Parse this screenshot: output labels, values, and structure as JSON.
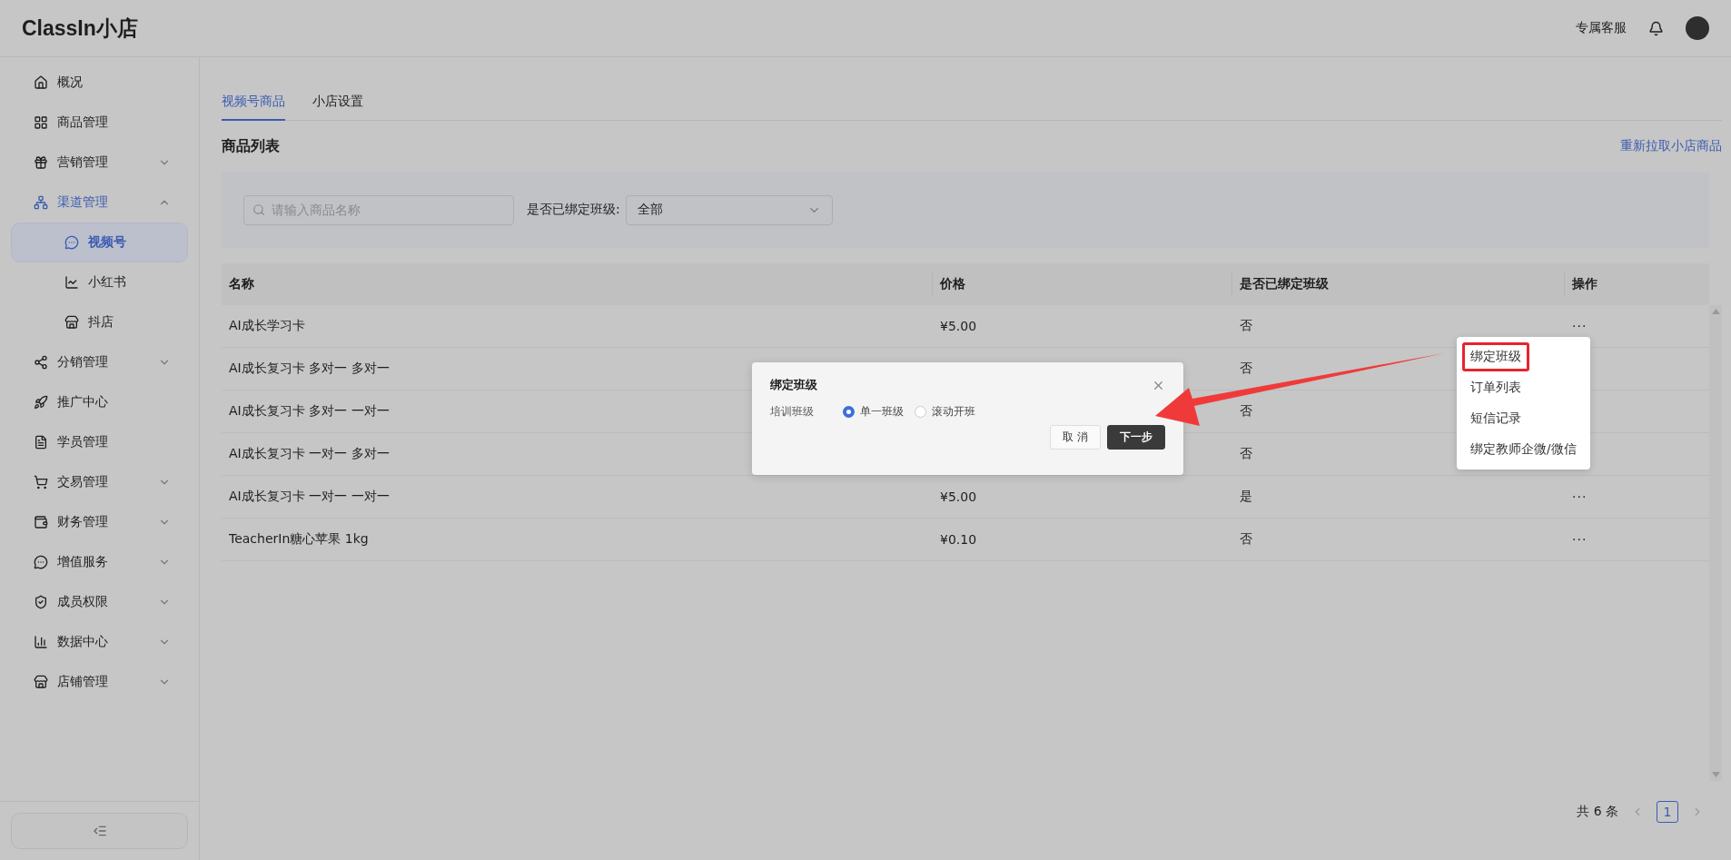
{
  "header": {
    "logo": "ClassIn小店",
    "support_link": "专属客服"
  },
  "sidebar": {
    "items": [
      {
        "label": "概况",
        "selected": false
      },
      {
        "label": "商品管理",
        "selected": false
      },
      {
        "label": "营销管理",
        "selected": false,
        "expanded": false
      },
      {
        "label": "渠道管理",
        "selected": false,
        "expanded": true,
        "children": [
          {
            "label": "视频号",
            "selected": true
          },
          {
            "label": "小红书",
            "selected": false
          },
          {
            "label": "抖店",
            "selected": false
          }
        ]
      },
      {
        "label": "分销管理",
        "selected": false,
        "expanded": false
      },
      {
        "label": "推广中心",
        "selected": false
      },
      {
        "label": "学员管理",
        "selected": false
      },
      {
        "label": "交易管理",
        "selected": false,
        "expanded": false
      },
      {
        "label": "财务管理",
        "selected": false,
        "expanded": false
      },
      {
        "label": "增值服务",
        "selected": false,
        "expanded": false
      },
      {
        "label": "成员权限",
        "selected": false,
        "expanded": false
      },
      {
        "label": "数据中心",
        "selected": false,
        "expanded": false
      },
      {
        "label": "店铺管理",
        "selected": false,
        "expanded": false
      }
    ]
  },
  "tabs": [
    {
      "label": "视频号商品",
      "selected": true
    },
    {
      "label": "小店设置",
      "selected": false
    }
  ],
  "section": {
    "title": "商品列表",
    "action": "重新拉取小店商品"
  },
  "filters": {
    "search": {
      "placeholder": "请输入商品名称"
    },
    "bound_label": "是否已绑定班级:",
    "bound_value": "全部"
  },
  "table": {
    "columns": [
      "名称",
      "价格",
      "是否已绑定班级",
      "操作"
    ],
    "rows": [
      {
        "name": "AI成长学习卡",
        "price": "¥5.00",
        "bound": "否",
        "ops": "···"
      },
      {
        "name": "AI成长复习卡 多对一 多对一",
        "bound": "否"
      },
      {
        "name": "AI成长复习卡 多对一 一对一",
        "bound": "否"
      },
      {
        "name": "AI成长复习卡 一对一 多对一",
        "bound": "否"
      },
      {
        "name": "AI成长复习卡 一对一 一对一",
        "price": "¥5.00",
        "bound": "是",
        "ops": "···"
      },
      {
        "name": "TeacherIn糖心苹果 1kg",
        "price": "¥0.10",
        "bound": "否",
        "ops": "···"
      }
    ]
  },
  "pagination": {
    "total": "共 6 条",
    "pages": [
      {
        "label": "1",
        "selected": true
      }
    ]
  },
  "menu": {
    "items": [
      {
        "label": "绑定班级",
        "highlighted": true
      },
      {
        "label": "订单列表",
        "highlighted": false
      },
      {
        "label": "短信记录",
        "highlighted": false
      },
      {
        "label": "绑定教师企微/微信",
        "highlighted": false
      }
    ]
  },
  "dialog": {
    "title": "绑定班级",
    "field_label": "培训班级",
    "options": [
      {
        "label": "单一班级",
        "selected": true
      },
      {
        "label": "滚动开班",
        "selected": false
      }
    ],
    "buttons": [
      {
        "label": "取 消",
        "kind": "secondary"
      },
      {
        "label": "下一步",
        "kind": "primary"
      }
    ]
  }
}
